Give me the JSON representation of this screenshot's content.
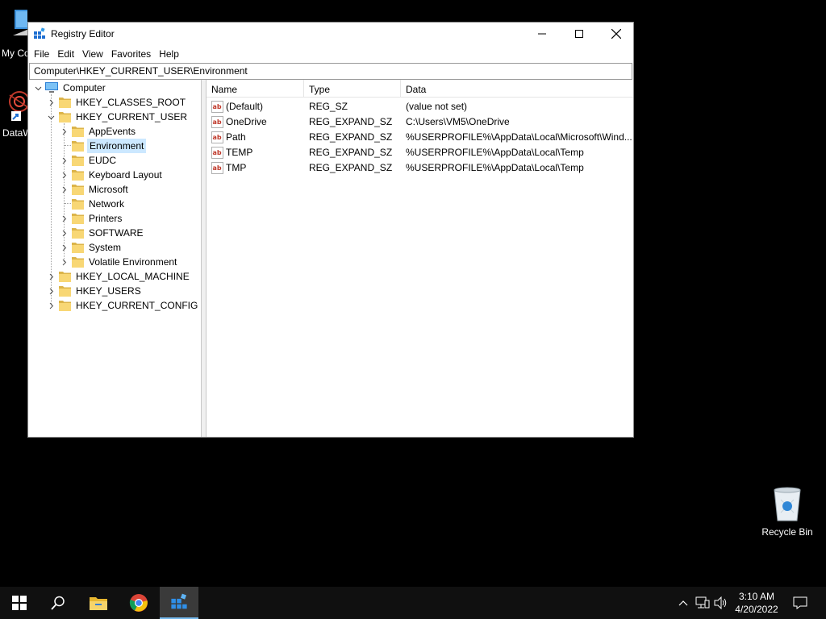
{
  "desktop": {
    "icons": [
      {
        "label": "My Co"
      },
      {
        "label": "DataW"
      },
      {
        "label": "Recycle Bin"
      }
    ]
  },
  "window": {
    "title": "Registry Editor",
    "menu": [
      "File",
      "Edit",
      "View",
      "Favorites",
      "Help"
    ],
    "address": "Computer\\HKEY_CURRENT_USER\\Environment"
  },
  "tree": {
    "root": "Computer",
    "nodes": [
      {
        "label": "HKEY_CLASSES_ROOT",
        "expander": "collapsed"
      },
      {
        "label": "HKEY_CURRENT_USER",
        "expander": "expanded"
      },
      {
        "label": "AppEvents",
        "expander": "collapsed"
      },
      {
        "label": "Environment",
        "expander": "none",
        "selected": true
      },
      {
        "label": "EUDC",
        "expander": "collapsed"
      },
      {
        "label": "Keyboard Layout",
        "expander": "collapsed"
      },
      {
        "label": "Microsoft",
        "expander": "collapsed"
      },
      {
        "label": "Network",
        "expander": "none"
      },
      {
        "label": "Printers",
        "expander": "collapsed"
      },
      {
        "label": "SOFTWARE",
        "expander": "collapsed"
      },
      {
        "label": "System",
        "expander": "collapsed"
      },
      {
        "label": "Volatile Environment",
        "expander": "collapsed"
      },
      {
        "label": "HKEY_LOCAL_MACHINE",
        "expander": "collapsed"
      },
      {
        "label": "HKEY_USERS",
        "expander": "collapsed"
      },
      {
        "label": "HKEY_CURRENT_CONFIG",
        "expander": "collapsed"
      }
    ]
  },
  "list": {
    "columns": [
      "Name",
      "Type",
      "Data"
    ],
    "rows": [
      {
        "name": "(Default)",
        "type": "REG_SZ",
        "data": "(value not set)"
      },
      {
        "name": "OneDrive",
        "type": "REG_EXPAND_SZ",
        "data": "C:\\Users\\VM5\\OneDrive"
      },
      {
        "name": "Path",
        "type": "REG_EXPAND_SZ",
        "data": "%USERPROFILE%\\AppData\\Local\\Microsoft\\Wind..."
      },
      {
        "name": "TEMP",
        "type": "REG_EXPAND_SZ",
        "data": "%USERPROFILE%\\AppData\\Local\\Temp"
      },
      {
        "name": "TMP",
        "type": "REG_EXPAND_SZ",
        "data": "%USERPROFILE%\\AppData\\Local\\Temp"
      }
    ]
  },
  "taskbar": {
    "time": "3:10 AM",
    "date": "4/20/2022"
  },
  "colors": {
    "selection": "#cce8ff",
    "folder": "#f8d775",
    "taskbar": "#101010",
    "active_accent": "#76b9ed"
  }
}
